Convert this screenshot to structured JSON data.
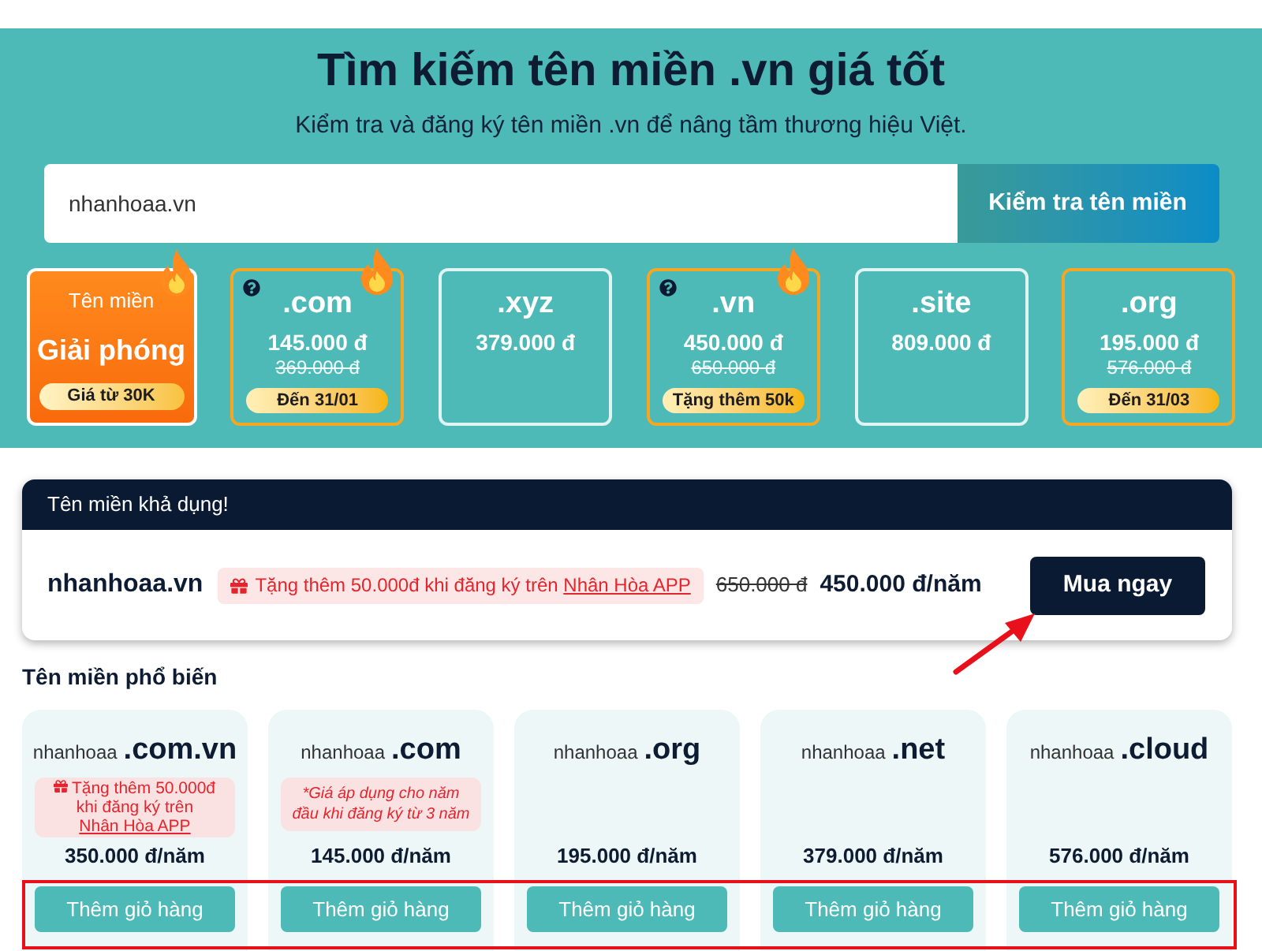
{
  "hero": {
    "title": "Tìm kiếm tên miền .vn giá tốt",
    "subtitle": "Kiểm tra và đăng ký tên miền .vn để nâng tầm thương hiệu Việt."
  },
  "search": {
    "value": "nhanhoaa.vn",
    "button": "Kiểm tra tên miền"
  },
  "extensions": [
    {
      "kind": "promo",
      "label": "Tên miền",
      "name": "Giải phóng",
      "badge": "Giá từ 30K",
      "hot": true
    },
    {
      "kind": "tld",
      "name": ".com",
      "price": "145.000 đ",
      "old_price": "369.000 đ",
      "badge": "Đến 31/01",
      "hot": true,
      "info": true,
      "featured": true
    },
    {
      "kind": "tld",
      "name": ".xyz",
      "price": "379.000 đ",
      "hot": false,
      "info": false,
      "featured": false
    },
    {
      "kind": "tld",
      "name": ".vn",
      "price": "450.000 đ",
      "old_price": "650.000 đ",
      "badge": "Tặng thêm 50k",
      "hot": true,
      "info": true,
      "featured": true
    },
    {
      "kind": "tld",
      "name": ".site",
      "price": "809.000 đ",
      "hot": false,
      "info": false,
      "featured": false
    },
    {
      "kind": "tld",
      "name": ".org",
      "price": "195.000 đ",
      "old_price": "576.000 đ",
      "badge": "Đến 31/03",
      "hot": false,
      "info": false,
      "featured": true
    }
  ],
  "result": {
    "header": "Tên miền khả dụng!",
    "domain": "nhanhoaa.vn",
    "promo": {
      "text": "Tặng thêm 50.000đ khi đăng ký trên",
      "link": "Nhân Hòa APP"
    },
    "old_price": "650.000 đ",
    "price": "450.000 đ/năm",
    "button": "Mua ngay"
  },
  "popular": {
    "title": "Tên miền phổ biến",
    "items": [
      {
        "name": "nhanhoaa",
        "tld": ".com.vn",
        "note": {
          "kind": "gift",
          "text": "Tặng thêm 50.000đ khi đăng ký trên",
          "link": "Nhân Hòa APP"
        },
        "price": "350.000 đ/năm",
        "button": "Thêm giỏ hàng"
      },
      {
        "name": "nhanhoaa",
        "tld": ".com",
        "note": {
          "kind": "info",
          "text": "*Giá áp dụng cho năm đầu khi đăng ký từ 3 năm"
        },
        "price": "145.000 đ/năm",
        "button": "Thêm giỏ hàng"
      },
      {
        "name": "nhanhoaa",
        "tld": ".org",
        "price": "195.000 đ/năm",
        "button": "Thêm giỏ hàng"
      },
      {
        "name": "nhanhoaa",
        "tld": ".net",
        "price": "379.000 đ/năm",
        "button": "Thêm giỏ hàng"
      },
      {
        "name": "nhanhoaa",
        "tld": ".cloud",
        "price": "576.000 đ/năm",
        "button": "Thêm giỏ hàng"
      }
    ]
  }
}
